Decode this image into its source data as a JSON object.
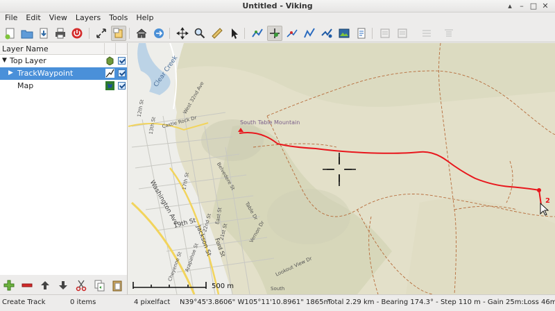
{
  "window": {
    "title": "Untitled - Viking",
    "controls": [
      "▴",
      "–",
      "□",
      "✕"
    ]
  },
  "menu": [
    "File",
    "Edit",
    "View",
    "Layers",
    "Tools",
    "Help"
  ],
  "toolbar": {
    "buttons": [
      "new-icon",
      "open-icon",
      "save-icon",
      "print-icon",
      "exit-icon",
      "fullscreen-icon",
      "layer-toggle-icon",
      "home-icon",
      "goto-icon",
      "pan-icon",
      "zoom-icon",
      "ruler-icon",
      "select-icon",
      "create-track-icon",
      "edit-waypoint-icon",
      "edit-trackpoint-icon",
      "route-finder-icon",
      "show-picture-icon",
      "georef-icon",
      "tb-disabled-1",
      "tb-disabled-2",
      "tb-disabled-3",
      "tb-disabled-4"
    ]
  },
  "layers_panel": {
    "header": "Layer Name",
    "rows": [
      {
        "label": "Top Layer"
      },
      {
        "label": "TrackWaypoint"
      },
      {
        "label": "Map"
      }
    ]
  },
  "map": {
    "scale_label": "500 m",
    "labels": [
      "South Table Mountain",
      "Clear Creek",
      "West 32nd Ave",
      "Castle Rock Dr",
      "13th St",
      "12th St",
      "17th St",
      "Washington Ave",
      "19th St",
      "Jackson St",
      "Ford St",
      "East St",
      "22nd St",
      "21st St",
      "Cheyenne St",
      "Table Dr",
      "Vernon Dr",
      "Lookout View Dr",
      "Belvedere St",
      "Arapahoe St",
      "South"
    ],
    "marker_label": "2",
    "colors": {
      "track": "#e8161c",
      "trail": "#b66b3a",
      "road_main": "#f2d45c"
    }
  },
  "status": {
    "tool": "Create Track",
    "items": "0 items",
    "zoom": "4 pixelfact",
    "position": "N39°45'3.8606\" W105°11'10.8961\" 1865m",
    "track_info": "Total 2.29 km - Bearing 174.3° - Step 110 m - Gain 25m:Loss 46m"
  }
}
